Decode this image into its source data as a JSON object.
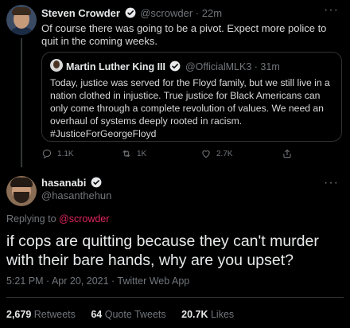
{
  "parent_tweet": {
    "name": "Steven Crowder",
    "handle": "@scrowder",
    "time": "· 22m",
    "text": "Of course there was going to be a pivot. Expect more police to quit in the coming weeks.",
    "quote": {
      "name": "Martin Luther King III",
      "handle": "@OfficialMLK3",
      "time": "· 31m",
      "text": "Today, justice was served for the Floyd family, but we still live in a nation clothed in injustice. True justice for Black Americans can only come through a complete revolution of values. We need an overhaul of systems deeply rooted in racism. #JusticeForGeorgeFloyd"
    },
    "actions": {
      "replies": "1.1K",
      "retweets": "1K",
      "likes": "2.7K"
    }
  },
  "main_tweet": {
    "name": "hasanabi",
    "handle": "@hasanthehun",
    "replying_prefix": "Replying to ",
    "replying_to": "@scrowder",
    "text": "if cops are quitting because they can't murder with their bare hands, why are you upset?",
    "meta": "5:21 PM · Apr 20, 2021 · Twitter Web App",
    "stats": {
      "retweets_count": "2,679",
      "retweets_label": "Retweets",
      "quotes_count": "64",
      "quotes_label": "Quote Tweets",
      "likes_count": "20.7K",
      "likes_label": "Likes"
    }
  },
  "more_glyph": "···",
  "colors": {
    "background": "#000000",
    "verified": "#1d9bf0",
    "mention": "#e0245e",
    "muted": "#71767b"
  },
  "icons": [
    "verified-badge-icon",
    "more-icon",
    "reply-icon",
    "retweet-icon",
    "like-icon",
    "share-icon"
  ]
}
